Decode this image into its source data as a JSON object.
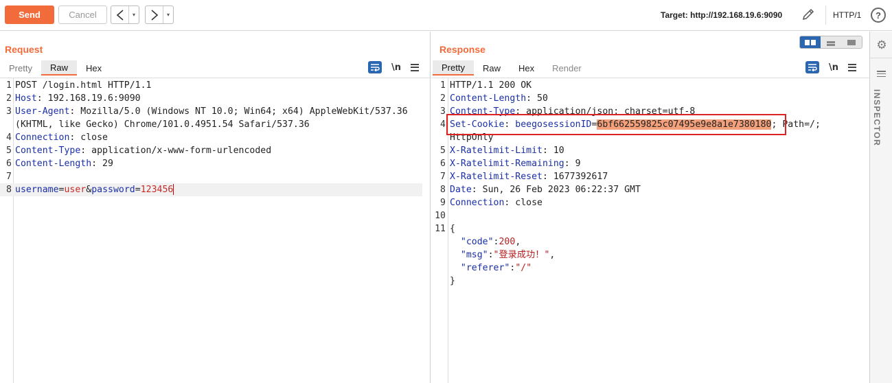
{
  "toolbar": {
    "send_label": "Send",
    "cancel_label": "Cancel",
    "back_glyph": "<",
    "forward_glyph": ">",
    "dropdown_glyph": "▾",
    "target_label": "Target: http://192.168.19.6:9090",
    "http_version": "HTTP/1",
    "help_glyph": "?",
    "accent_color": "#f26b3a"
  },
  "request": {
    "title": "Request",
    "tabs": [
      "Pretty",
      "Raw",
      "Hex"
    ],
    "active_tab": "Raw",
    "newline_label": "\\n",
    "lines": {
      "l1": "POST /login.html HTTP/1.1",
      "l2_name": "Host",
      "l2_value": ": 192.168.19.6:9090",
      "l3_name": "User-Agent",
      "l3_value": ": Mozilla/5.0 (Windows NT 10.0; Win64; x64) AppleWebKit/537.36",
      "l3_cont": "(KHTML, like Gecko) Chrome/101.0.4951.54 Safari/537.36",
      "l4_name": "Connection",
      "l4_value": ": close",
      "l5_name": "Content-Type",
      "l5_value": ": application/x-www-form-urlencoded",
      "l6_name": "Content-Length",
      "l6_value": ": 29",
      "l8_p1": "username",
      "l8_eq1": "=",
      "l8_v1": "user",
      "l8_amp": "&",
      "l8_p2": "password",
      "l8_eq2": "=",
      "l8_v2": "123456"
    },
    "line_numbers": [
      "1",
      "2",
      "3",
      "4",
      "5",
      "6",
      "7",
      "8"
    ]
  },
  "response": {
    "title": "Response",
    "tabs": [
      "Pretty",
      "Raw",
      "Hex",
      "Render"
    ],
    "active_tab": "Pretty",
    "newline_label": "\\n",
    "lines": {
      "l1": "HTTP/1.1 200 OK",
      "l2_name": "Content-Length",
      "l2_value": ": 50",
      "l3_name": "Content-Type",
      "l3_value": ": application/json; charset=utf-8",
      "l4_name": "Set-Cookie",
      "l4_sep": ": ",
      "l4_cookie_name": "beegosessionID",
      "l4_eq": "=",
      "l4_cookie_value": "6bf662559825c07495e9e8a1e7380180",
      "l4_rest": "; Path=/;",
      "l4_cont": "HttpOnly",
      "l5_name": "X-Ratelimit-Limit",
      "l5_value": ": 10",
      "l6_name": "X-Ratelimit-Remaining",
      "l6_value": ": 9",
      "l7_name": "X-Ratelimit-Reset",
      "l7_value": ": 1677392617",
      "l8_name": "Date",
      "l8_value": ": Sun, 26 Feb 2023 06:22:37 GMT",
      "l9_name": "Connection",
      "l9_value": ": close",
      "l11_open": "{",
      "j1_key": "\"code\"",
      "j1_colon": ":",
      "j1_val": "200",
      "j1_comma": ",",
      "j2_key": "\"msg\"",
      "j2_colon": ":",
      "j2_val_q1": "\"",
      "j2_val": "登录成功！",
      "j2_val_q2": "\"",
      "j2_comma": ",",
      "j3_key": "\"referer\"",
      "j3_colon": ":",
      "j3_val": "\"/\"",
      "close": "}"
    },
    "line_numbers": [
      "1",
      "2",
      "3",
      "4",
      "5",
      "6",
      "7",
      "8",
      "9",
      "10",
      "11"
    ]
  },
  "inspector": {
    "label": "INSPECTOR",
    "gear_glyph": "⚙"
  }
}
